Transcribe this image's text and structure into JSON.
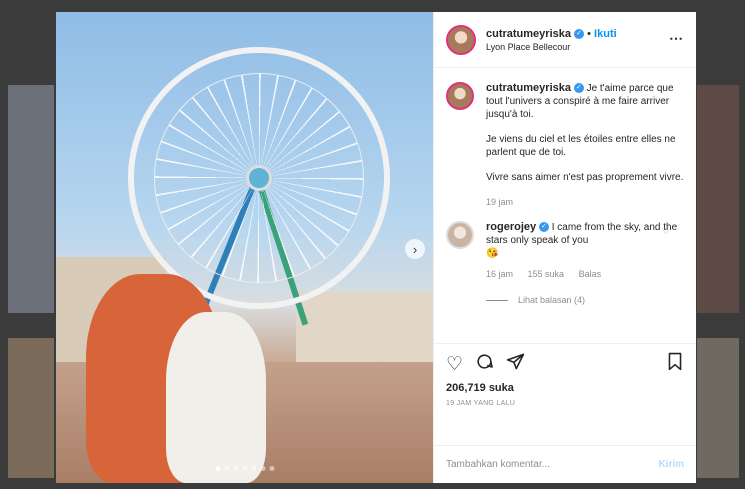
{
  "post": {
    "username": "cutratumeyriska",
    "verified_mark": "✓",
    "separator": "•",
    "follow_label": "Ikuti",
    "location": "Lyon Place Bellecour",
    "more_icon": "⋯",
    "slide_count": 7,
    "active_slide": 0
  },
  "caption": {
    "username": "cutratumeyriska",
    "line1": "Je t'aime parce que tout l'univers a conspiré à me faire arriver jusqu'à toi.",
    "line2": "Je viens du ciel et les étoiles entre elles ne parlent que de toi.",
    "line3": "Vivre sans aimer n'est pas proprement vivre.",
    "time": "19 jam"
  },
  "comment": {
    "username": "rogerojey",
    "text": "I came from the sky, and the stars only speak of you",
    "emoji": "😘",
    "time": "16 jam",
    "likes": "155 suka",
    "reply_label": "Balas",
    "view_replies": "Lihat balasan (4)"
  },
  "actions": {
    "likes": "206,719 suka",
    "timestamp": "19 JAM YANG LALU"
  },
  "composer": {
    "placeholder": "Tambahkan komentar...",
    "post_label": "Kirim"
  },
  "icons": {
    "like": "heart-icon",
    "comment": "comment-icon",
    "share": "share-icon",
    "save": "bookmark-icon",
    "next": "chevron-right-icon"
  },
  "colors": {
    "accent": "#0095f6",
    "verified": "#3897f0",
    "post_disabled": "#b3dbff"
  }
}
